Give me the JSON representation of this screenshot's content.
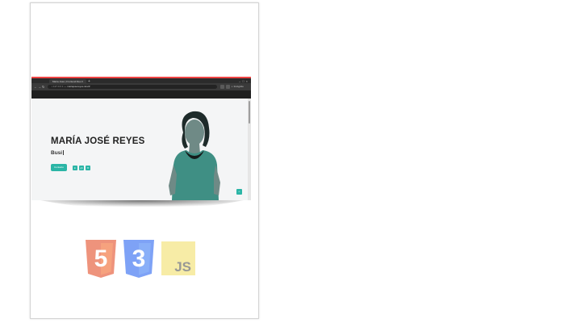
{
  "browser": {
    "tab_title": "María José | Frontend Dev...",
    "tab_close": "×",
    "new_tab": "+",
    "window_controls": "–□×",
    "nav": {
      "back": "←",
      "forward": "→",
      "reload": "↻"
    },
    "url_host": "▪ 127.0.0.1",
    "url_path": " — mariajosereyes.dev/#",
    "incognito": "◐ Incógnito"
  },
  "hero": {
    "name": "MARÍA JOSÉ REYES",
    "role_typed": "Busi",
    "cta_label": "Contacto",
    "social": [
      "in",
      "gh",
      "✉"
    ],
    "back_to_top": "^"
  },
  "tech_logos": [
    {
      "label": "5",
      "name": "HTML5",
      "color": "#e44d26"
    },
    {
      "label": "3",
      "name": "CSS3",
      "color": "#2965f1"
    },
    {
      "label": "JS",
      "name": "JavaScript",
      "color": "#f0db4f"
    }
  ],
  "colors": {
    "accent": "#2bb5a6",
    "browser_dark": "#2b2b2b",
    "page_bg": "#f4f5f6"
  }
}
